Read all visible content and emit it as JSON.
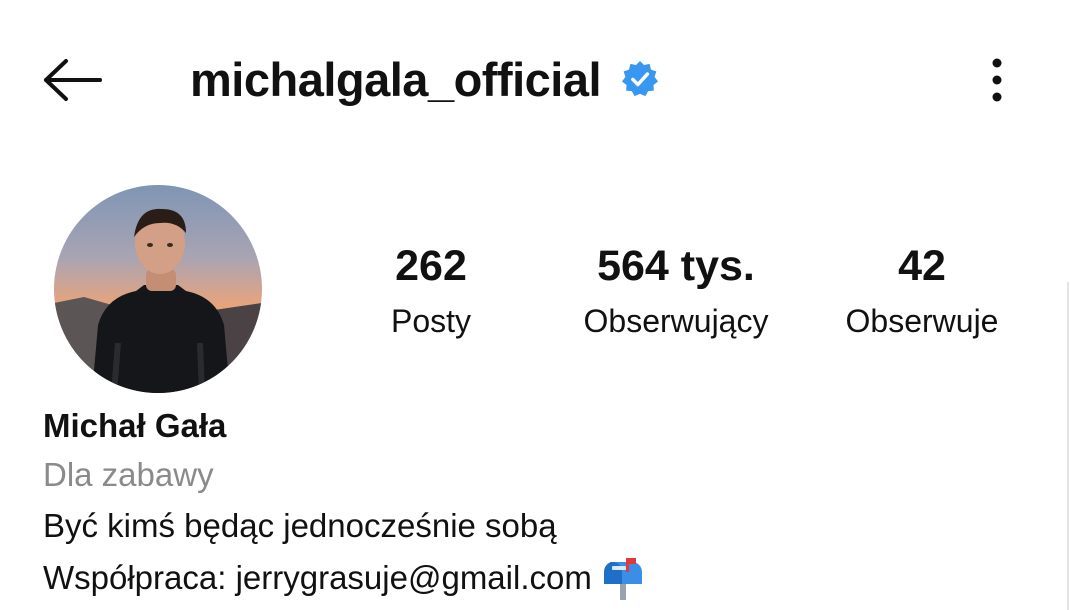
{
  "header": {
    "username": "michalgala_official",
    "back_icon": "arrow-left-icon",
    "verified_icon": "verified-badge-icon",
    "verified_color": "#3897f0",
    "more_icon": "more-vertical-icon"
  },
  "stats": {
    "posts": {
      "value": "262",
      "label": "Posty"
    },
    "followers": {
      "value": "564 tys.",
      "label": "Obserwujący"
    },
    "following": {
      "value": "42",
      "label": "Obserwuje"
    }
  },
  "bio": {
    "name": "Michał Gała",
    "category": "Dla zabawy",
    "lines": [
      "Być kimś będąc jednocześnie sobą",
      "Współpraca: jerrygrasuje@gmail.com"
    ],
    "mailbox_icon": "mailbox-icon"
  },
  "colors": {
    "text": "#111111",
    "muted": "#8a8a8a",
    "background": "#ffffff"
  }
}
